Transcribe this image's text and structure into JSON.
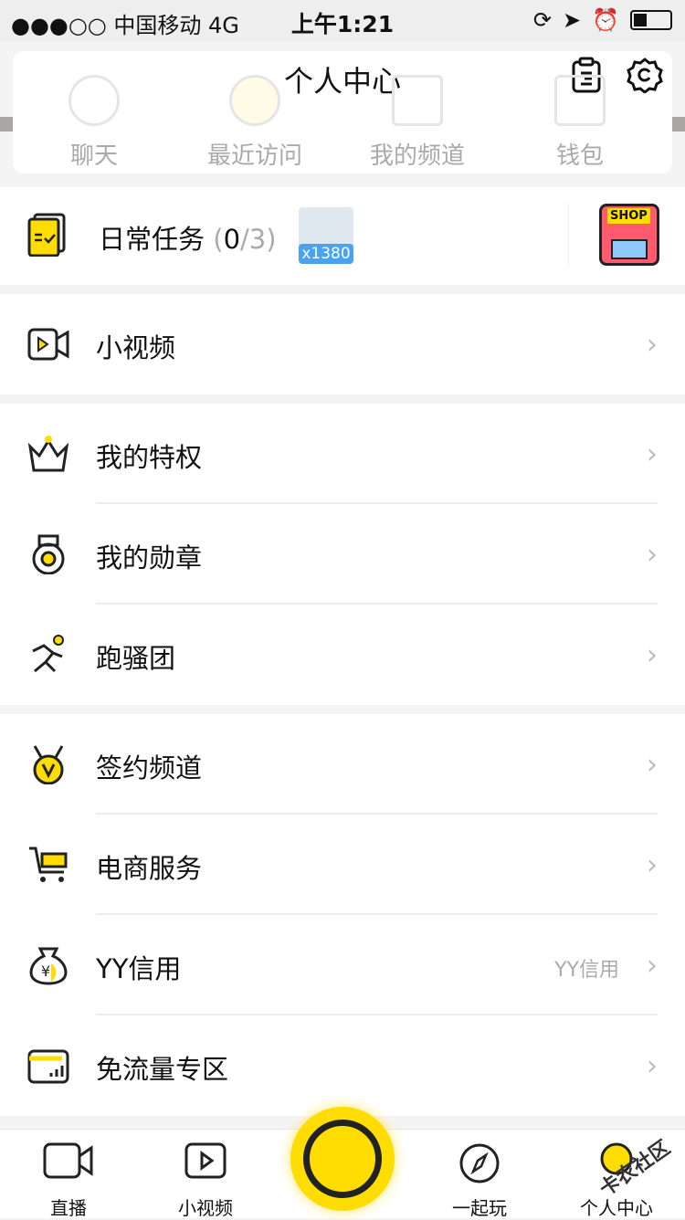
{
  "status_bar": {
    "carrier": "●●●○○ 中国移动   4G",
    "time": "上午1:21"
  },
  "header": {
    "title": "个人中心",
    "quick": [
      {
        "label": "聊天",
        "icon": "chat-icon"
      },
      {
        "label": "最近访问",
        "icon": "clock-icon"
      },
      {
        "label": "我的频道",
        "icon": "home-icon"
      },
      {
        "label": "钱包",
        "icon": "wallet-icon"
      }
    ]
  },
  "daily_task": {
    "label": "日常任务",
    "progress_open": "(",
    "done": "0",
    "total": "/3)",
    "reward": "x1380",
    "shop": "SHOP"
  },
  "menu": [
    {
      "label": "小视频",
      "icon": "video-camera-icon"
    },
    {
      "label": "我的特权",
      "icon": "crown-icon"
    },
    {
      "label": "我的勋章",
      "icon": "medal-icon"
    },
    {
      "label": "跑骚团",
      "icon": "runner-icon"
    },
    {
      "label": "签约频道",
      "icon": "v-medal-icon"
    },
    {
      "label": "电商服务",
      "icon": "cart-icon"
    },
    {
      "label": "YY信用",
      "icon": "money-bag-icon",
      "sub": "YY信用"
    },
    {
      "label": "免流量专区",
      "icon": "data-card-icon"
    }
  ],
  "tabbar": [
    {
      "label": "直播"
    },
    {
      "label": "小视频"
    },
    {
      "label": "一起玩"
    },
    {
      "label": "个人中心"
    }
  ],
  "watermark": "卡农社区",
  "colors": {
    "accent": "#ffdd00"
  }
}
